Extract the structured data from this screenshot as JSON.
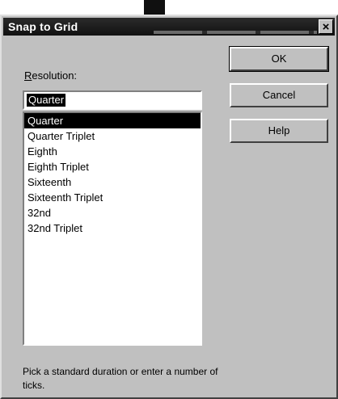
{
  "dialog": {
    "title": "Snap to Grid",
    "close_glyph": "×"
  },
  "resolution": {
    "label_prefix": "R",
    "label_rest": "esolution:",
    "value": "Quarter"
  },
  "list": {
    "items": [
      "Quarter",
      "Quarter Triplet",
      "Eighth",
      "Eighth Triplet",
      "Sixteenth",
      "Sixteenth Triplet",
      "32nd",
      "32nd Triplet"
    ],
    "selected": "Quarter"
  },
  "buttons": {
    "ok": "OK",
    "cancel": "Cancel",
    "help": "Help"
  },
  "hint": "Pick a standard duration or enter a number of ticks.",
  "colors": {
    "dialog_face": "#c0c0c0",
    "titlebar": "#1a1a1a",
    "selection": "#000000"
  }
}
